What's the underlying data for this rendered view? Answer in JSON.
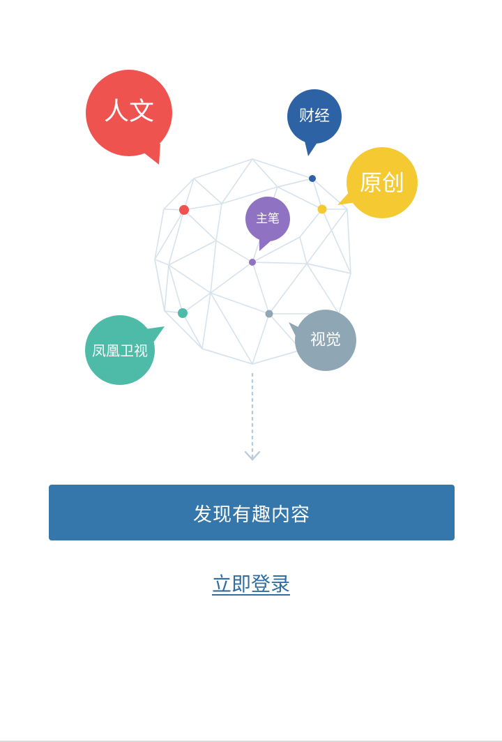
{
  "categories": {
    "humanities": "人文",
    "finance": "财经",
    "original": "原创",
    "editor": "主笔",
    "phoenix_tv": "凤凰卫视",
    "visual": "视觉"
  },
  "colors": {
    "humanities": "#ef5350",
    "finance": "#2d63a5",
    "original": "#f5c932",
    "editor": "#8f72c1",
    "phoenix_tv": "#4dbba8",
    "visual": "#8fa7b5",
    "primary_button": "#3677ab",
    "link": "#2f6da3",
    "globe_lines": "#d6e2ec"
  },
  "actions": {
    "discover_button": "发现有趣内容",
    "login_link": "立即登录"
  },
  "icons": {
    "scroll_hint": "dotted-arrow-down-icon",
    "globe": "geodesic-globe-icon"
  }
}
